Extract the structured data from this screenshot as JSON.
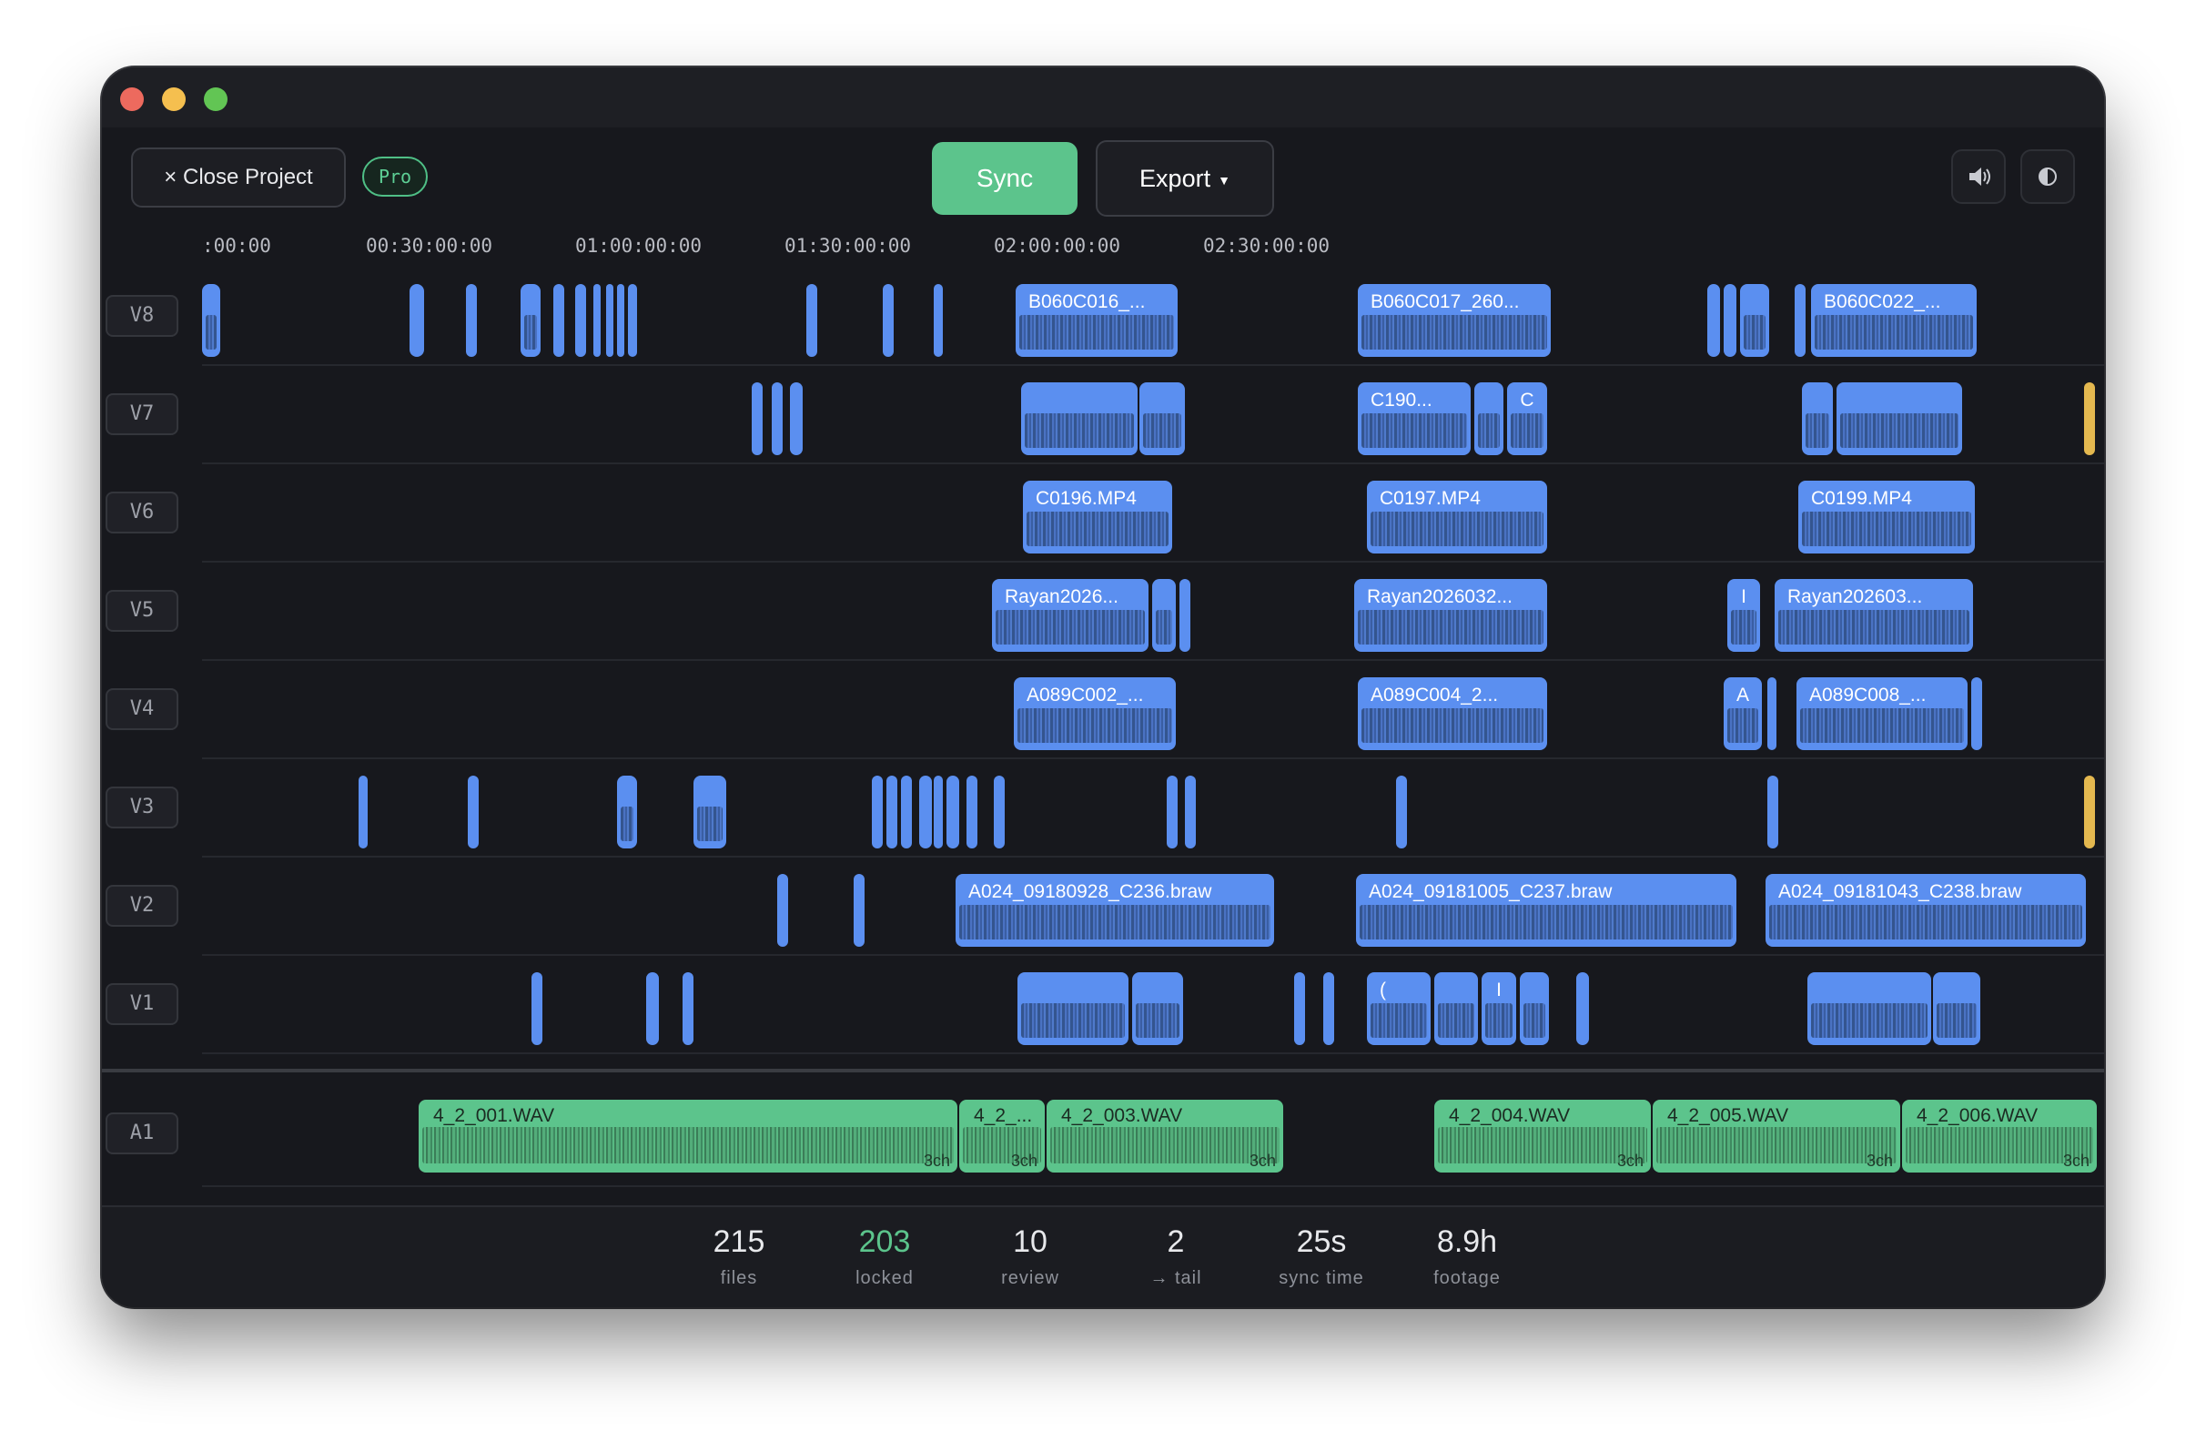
{
  "toolbar": {
    "close_label": "× Close Project",
    "badge": "Pro",
    "sync_label": "Sync",
    "export_label": "Export",
    "volume_icon": "volume-icon",
    "theme_icon": "contrast-icon"
  },
  "ruler": {
    "ticks": [
      ":00:00",
      "00:30:00:00",
      "01:00:00:00",
      "01:30:00:00",
      "02:00:00:00",
      "02:30:00:00"
    ]
  },
  "tracks": [
    {
      "label": "V8",
      "clips": [
        {
          "start": 0,
          "dur": 20
        },
        {
          "start": 228,
          "dur": 16
        },
        {
          "start": 290,
          "dur": 12
        },
        {
          "start": 350,
          "dur": 22
        },
        {
          "start": 386,
          "dur": 12
        },
        {
          "start": 410,
          "dur": 12
        },
        {
          "start": 430,
          "dur": 8
        },
        {
          "start": 444,
          "dur": 8
        },
        {
          "start": 456,
          "dur": 8
        },
        {
          "start": 468,
          "dur": 10
        },
        {
          "start": 664,
          "dur": 12
        },
        {
          "start": 748,
          "dur": 12
        },
        {
          "start": 804,
          "dur": 10
        },
        {
          "title": "B060C016_...",
          "start": 894,
          "dur": 178
        },
        {
          "title": "B060C017_260...",
          "start": 1270,
          "dur": 212
        },
        {
          "start": 1654,
          "dur": 14
        },
        {
          "start": 1672,
          "dur": 14
        },
        {
          "start": 1690,
          "dur": 32
        },
        {
          "start": 1750,
          "dur": 12
        },
        {
          "title": "B060C022_...",
          "start": 1768,
          "dur": 182
        }
      ]
    },
    {
      "label": "V7",
      "clips": [
        {
          "start": 604,
          "dur": 12
        },
        {
          "start": 626,
          "dur": 12
        },
        {
          "start": 646,
          "dur": 14
        },
        {
          "start": 900,
          "dur": 128
        },
        {
          "start": 1030,
          "dur": 50
        },
        {
          "title": "C190...",
          "start": 1270,
          "dur": 124
        },
        {
          "start": 1398,
          "dur": 32
        },
        {
          "title": "C",
          "start": 1434,
          "dur": 44
        },
        {
          "start": 1758,
          "dur": 34
        },
        {
          "start": 1796,
          "dur": 138
        },
        {
          "start": 2068,
          "dur": 12,
          "color": "#e4b84f"
        }
      ]
    },
    {
      "label": "V6",
      "clips": [
        {
          "title": "C0196.MP4",
          "start": 902,
          "dur": 164
        },
        {
          "title": "C0197.MP4",
          "start": 1280,
          "dur": 198
        },
        {
          "title": "C0199.MP4",
          "start": 1754,
          "dur": 194
        }
      ]
    },
    {
      "label": "V5",
      "clips": [
        {
          "title": "Rayan2026...",
          "start": 868,
          "dur": 172
        },
        {
          "start": 1044,
          "dur": 26
        },
        {
          "start": 1074,
          "dur": 12
        },
        {
          "title": "Rayan2026032...",
          "start": 1266,
          "dur": 212
        },
        {
          "title": "I",
          "start": 1676,
          "dur": 36
        },
        {
          "title": "Rayan202603...",
          "start": 1728,
          "dur": 218
        }
      ]
    },
    {
      "label": "V4",
      "clips": [
        {
          "title": "A089C002_...",
          "start": 892,
          "dur": 178
        },
        {
          "title": "A089C004_2...",
          "start": 1270,
          "dur": 208
        },
        {
          "title": "A",
          "start": 1672,
          "dur": 42
        },
        {
          "start": 1720,
          "dur": 10
        },
        {
          "title": "A089C008_...",
          "start": 1752,
          "dur": 188
        },
        {
          "start": 1944,
          "dur": 12
        }
      ]
    },
    {
      "label": "V3",
      "clips": [
        {
          "start": 172,
          "dur": 10
        },
        {
          "start": 292,
          "dur": 12
        },
        {
          "start": 456,
          "dur": 22
        },
        {
          "start": 540,
          "dur": 36
        },
        {
          "start": 736,
          "dur": 12
        },
        {
          "start": 752,
          "dur": 12
        },
        {
          "start": 768,
          "dur": 12
        },
        {
          "start": 788,
          "dur": 14
        },
        {
          "start": 804,
          "dur": 10
        },
        {
          "start": 818,
          "dur": 14
        },
        {
          "start": 840,
          "dur": 12
        },
        {
          "start": 870,
          "dur": 12
        },
        {
          "start": 1060,
          "dur": 12
        },
        {
          "start": 1080,
          "dur": 12
        },
        {
          "start": 1312,
          "dur": 12
        },
        {
          "start": 1720,
          "dur": 12
        },
        {
          "start": 2068,
          "dur": 12,
          "color": "#e4b84f"
        }
      ]
    },
    {
      "label": "V2",
      "clips": [
        {
          "start": 632,
          "dur": 12
        },
        {
          "start": 716,
          "dur": 12
        },
        {
          "title": "A024_09180928_C236.braw",
          "start": 828,
          "dur": 350
        },
        {
          "title": "A024_09181005_C237.braw",
          "start": 1268,
          "dur": 418
        },
        {
          "title": "A024_09181043_C238.braw",
          "start": 1718,
          "dur": 352
        }
      ]
    },
    {
      "label": "V1",
      "clips": [
        {
          "start": 362,
          "dur": 12
        },
        {
          "start": 488,
          "dur": 14
        },
        {
          "start": 528,
          "dur": 12
        },
        {
          "start": 896,
          "dur": 122
        },
        {
          "start": 1022,
          "dur": 56
        },
        {
          "start": 1200,
          "dur": 12
        },
        {
          "start": 1232,
          "dur": 12
        },
        {
          "title": "(",
          "start": 1280,
          "dur": 70
        },
        {
          "start": 1354,
          "dur": 48
        },
        {
          "title": "I",
          "start": 1406,
          "dur": 38
        },
        {
          "start": 1448,
          "dur": 32
        },
        {
          "start": 1510,
          "dur": 14
        },
        {
          "start": 1764,
          "dur": 136
        },
        {
          "start": 1902,
          "dur": 52
        }
      ]
    }
  ],
  "audio_track": {
    "label": "A1",
    "clips": [
      {
        "title": "4_2_001.WAV",
        "ch": "3ch",
        "start": 238,
        "dur": 592
      },
      {
        "title": "4_2_...",
        "ch": "3ch",
        "start": 832,
        "dur": 94
      },
      {
        "title": "4_2_003.WAV",
        "ch": "3ch",
        "start": 928,
        "dur": 260
      },
      {
        "title": "4_2_004.WAV",
        "ch": "3ch",
        "start": 1354,
        "dur": 238
      },
      {
        "title": "4_2_005.WAV",
        "ch": "3ch",
        "start": 1594,
        "dur": 272
      },
      {
        "title": "4_2_006.WAV",
        "ch": "3ch",
        "start": 1868,
        "dur": 214
      }
    ]
  },
  "stats": [
    {
      "value": "215",
      "label": "files"
    },
    {
      "value": "203",
      "label": "locked",
      "color": "#5cc48c"
    },
    {
      "value": "10",
      "label": "review"
    },
    {
      "value": "2",
      "label": "→ tail"
    },
    {
      "value": "25s",
      "label": "sync time"
    },
    {
      "value": "8.9h",
      "label": "footage"
    }
  ]
}
